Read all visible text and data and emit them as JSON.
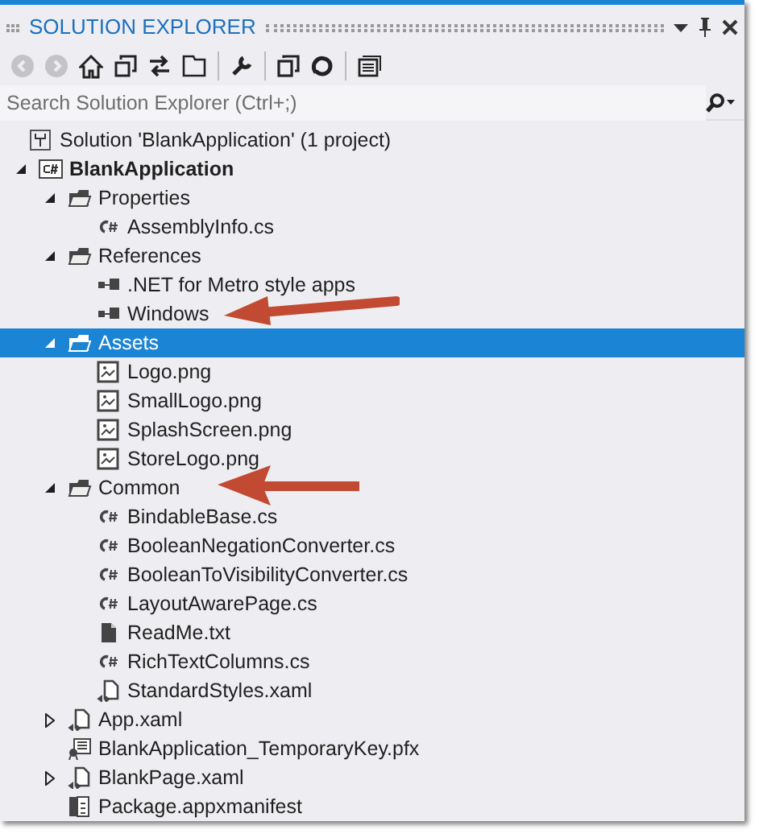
{
  "panel": {
    "title": "SOLUTION EXPLORER"
  },
  "search": {
    "placeholder": "Search Solution Explorer (Ctrl+;)"
  },
  "tree": [
    {
      "label": "Solution 'BlankApplication' (1 project)",
      "kind": "solution",
      "selected": false,
      "children": [
        {
          "label": "BlankApplication",
          "kind": "csproject",
          "bold": true,
          "expanded": true,
          "selected": false,
          "children": [
            {
              "label": "Properties",
              "kind": "folder",
              "expanded": true,
              "selected": false,
              "children": [
                {
                  "label": "AssemblyInfo.cs",
                  "kind": "csharp",
                  "selected": false
                }
              ]
            },
            {
              "label": "References",
              "kind": "folder",
              "expanded": true,
              "selected": false,
              "children": [
                {
                  "label": ".NET for Metro style apps",
                  "kind": "reference",
                  "selected": false
                },
                {
                  "label": "Windows",
                  "kind": "reference",
                  "selected": false
                }
              ]
            },
            {
              "label": "Assets",
              "kind": "folder",
              "expanded": true,
              "selected": true,
              "children": [
                {
                  "label": "Logo.png",
                  "kind": "image",
                  "selected": false
                },
                {
                  "label": "SmallLogo.png",
                  "kind": "image",
                  "selected": false
                },
                {
                  "label": "SplashScreen.png",
                  "kind": "image",
                  "selected": false
                },
                {
                  "label": "StoreLogo.png",
                  "kind": "image",
                  "selected": false
                }
              ]
            },
            {
              "label": "Common",
              "kind": "folder",
              "expanded": true,
              "selected": false,
              "children": [
                {
                  "label": "BindableBase.cs",
                  "kind": "csharp",
                  "selected": false
                },
                {
                  "label": "BooleanNegationConverter.cs",
                  "kind": "csharp",
                  "selected": false
                },
                {
                  "label": "BooleanToVisibilityConverter.cs",
                  "kind": "csharp",
                  "selected": false
                },
                {
                  "label": "LayoutAwarePage.cs",
                  "kind": "csharp",
                  "selected": false
                },
                {
                  "label": "ReadMe.txt",
                  "kind": "text",
                  "selected": false
                },
                {
                  "label": "RichTextColumns.cs",
                  "kind": "csharp",
                  "selected": false
                },
                {
                  "label": "StandardStyles.xaml",
                  "kind": "xaml",
                  "selected": false
                }
              ]
            },
            {
              "label": "App.xaml",
              "kind": "xaml",
              "expanded": false,
              "selected": false
            },
            {
              "label": "BlankApplication_TemporaryKey.pfx",
              "kind": "certificate",
              "selected": false
            },
            {
              "label": "BlankPage.xaml",
              "kind": "xaml",
              "expanded": false,
              "selected": false
            },
            {
              "label": "Package.appxmanifest",
              "kind": "manifest",
              "selected": false
            }
          ]
        }
      ]
    }
  ]
}
